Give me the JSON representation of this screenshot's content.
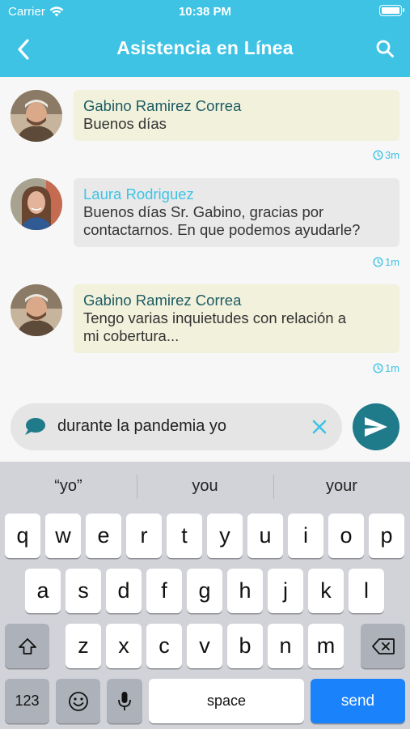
{
  "status_bar": {
    "carrier": "Carrier",
    "time": "10:38 PM"
  },
  "header": {
    "title": "Asistencia en Línea",
    "back_icon": "chevron-left-icon",
    "search_icon": "search-icon"
  },
  "messages": [
    {
      "sender": "Gabino Ramirez Correa",
      "role": "user",
      "lines": [
        "Buenos días"
      ],
      "time": "3m"
    },
    {
      "sender": "Laura Rodriguez",
      "role": "agent",
      "lines": [
        "Buenos días Sr. Gabino, gracias por",
        "contactarnos. En que podemos ayudarle?"
      ],
      "time": "1m"
    },
    {
      "sender": "Gabino Ramirez Correa",
      "role": "user",
      "lines": [
        "Tengo varias inquietudes con relación a",
        "mi cobertura..."
      ],
      "time": "1m"
    }
  ],
  "composer": {
    "value": "durante la pandemia yo",
    "chat_icon": "chat-bubble-icon",
    "clear_icon": "clear-icon",
    "send_icon": "send-icon"
  },
  "keyboard": {
    "suggestions": [
      "“yo”",
      "you",
      "your"
    ],
    "row1": [
      "q",
      "w",
      "e",
      "r",
      "t",
      "y",
      "u",
      "i",
      "o",
      "p"
    ],
    "row2": [
      "a",
      "s",
      "d",
      "f",
      "g",
      "h",
      "j",
      "k",
      "l"
    ],
    "row3": [
      "z",
      "x",
      "c",
      "v",
      "b",
      "n",
      "m"
    ],
    "numbers_label": "123",
    "space_label": "space",
    "send_label": "send"
  },
  "colors": {
    "header": "#3ec3e5",
    "user_bubble": "#f1f1dc",
    "agent_bubble": "#e9e9e9",
    "send_button": "#1f7a8a",
    "keyboard_send": "#1a82fb"
  }
}
